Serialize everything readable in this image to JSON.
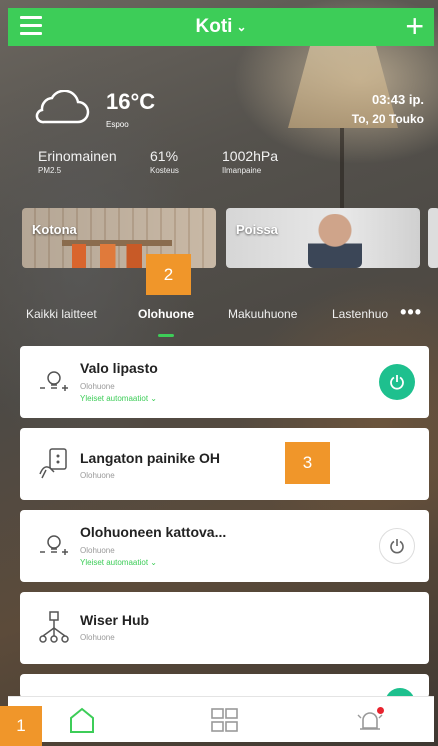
{
  "header": {
    "title": "Koti",
    "chevron": "⌄",
    "add_label": "+"
  },
  "weather": {
    "temperature": "16°C",
    "city": "Espoo",
    "time": "03:43 ip.",
    "date": "To, 20 Touko",
    "stats": [
      {
        "value": "Erinomainen",
        "label": "PM2.5"
      },
      {
        "value": "61%",
        "label": "Kosteus"
      },
      {
        "value": "1002hPa",
        "label": "Ilmanpaine"
      }
    ]
  },
  "scenes": [
    {
      "label": "Kotona"
    },
    {
      "label": "Poissa"
    }
  ],
  "badges": {
    "b1": "1",
    "b2": "2",
    "b3": "3"
  },
  "tabs": {
    "items": [
      {
        "label": "Kaikki laitteet"
      },
      {
        "label": "Olohuone"
      },
      {
        "label": "Makuuhuone"
      },
      {
        "label": "Lastenhuo"
      }
    ],
    "more": "•••",
    "active_index": 1
  },
  "devices": [
    {
      "name": "Valo lipasto",
      "room": "Olohuone",
      "automation": "Yleiset automaatiot ⌄",
      "power": "on"
    },
    {
      "name": "Langaton painike OH",
      "room": "Olohuone"
    },
    {
      "name": "Olohuoneen kattova...",
      "room": "Olohuone",
      "automation": "Yleiset automaatiot ⌄",
      "power": "off"
    },
    {
      "name": "Wiser Hub",
      "room": "Olohuone"
    }
  ],
  "colors": {
    "brand_green": "#3dcd58",
    "power_on": "#1ec08e",
    "badge_orange": "#f0962a",
    "alert_red": "#e8232e"
  },
  "bottom_nav": {
    "icons": [
      "home-icon",
      "grid-icon",
      "alarm-bell-icon"
    ]
  }
}
